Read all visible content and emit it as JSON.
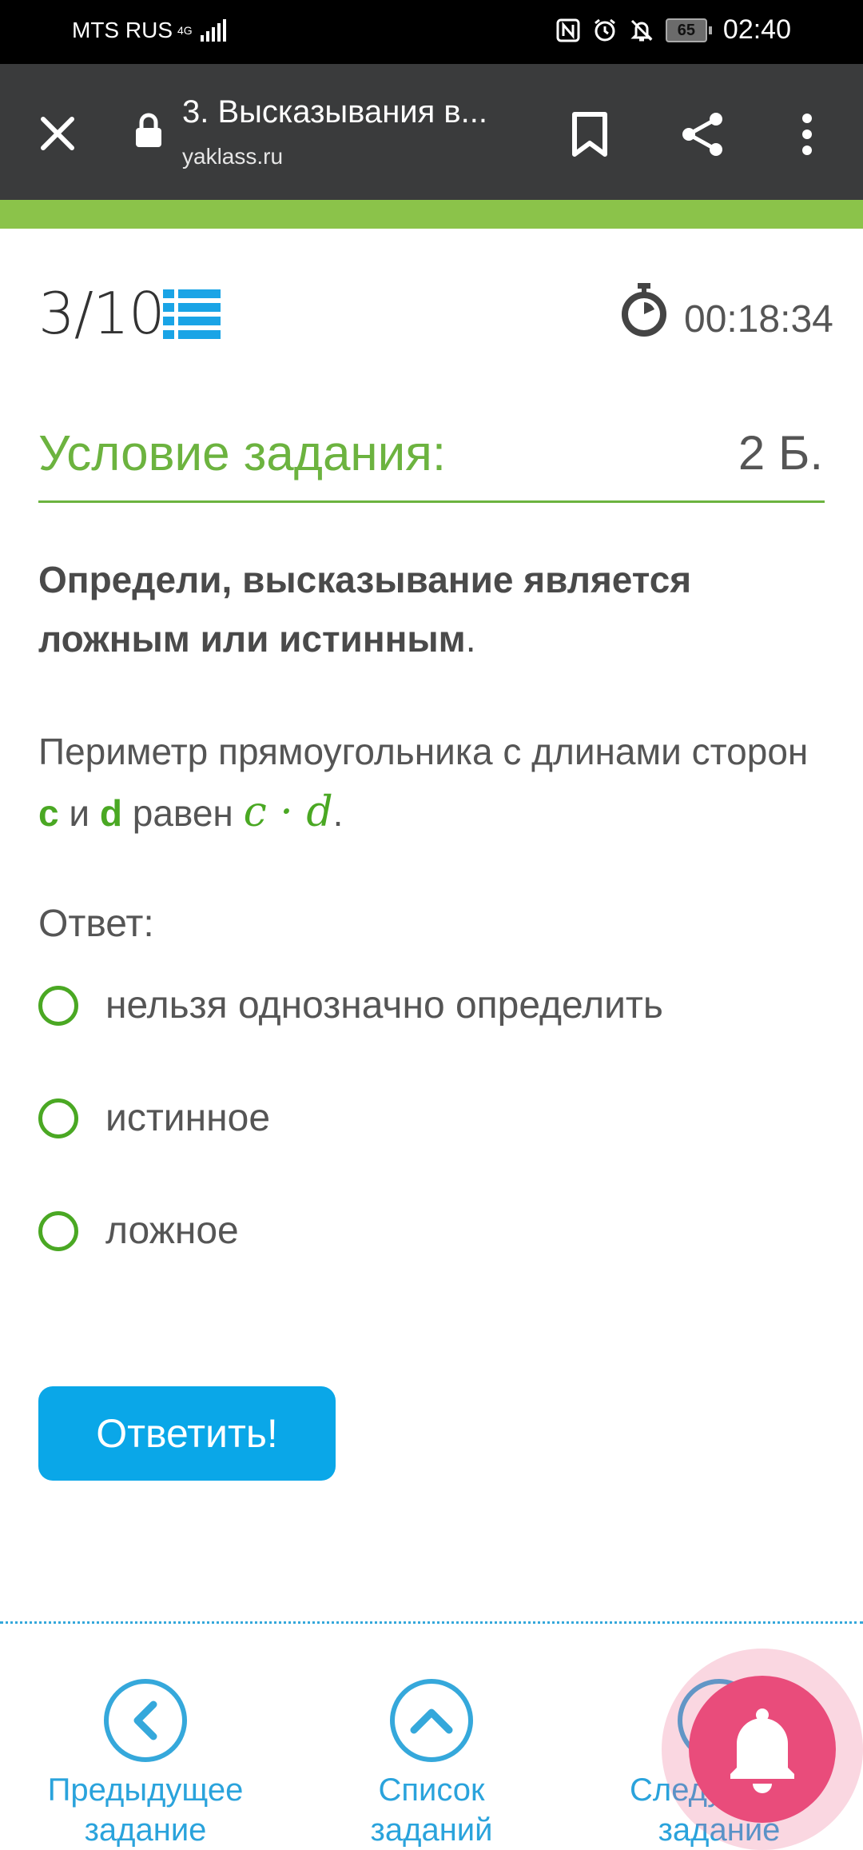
{
  "status_bar": {
    "carrier": "MTS RUS",
    "network": "4G",
    "battery": "65",
    "time": "02:40"
  },
  "browser": {
    "title": "3. Высказывания в...",
    "url": "yaklass.ru",
    "icons": [
      "close-icon",
      "lock-icon",
      "bookmark-icon",
      "share-icon",
      "more-vertical-icon"
    ]
  },
  "header": {
    "progress": "3/10",
    "timer": "00:18:34"
  },
  "section": {
    "title": "Условие задания:",
    "points": "2 Б."
  },
  "question": {
    "instruction": "Определи, высказывание является ложным или истинным",
    "instruction_end": ".",
    "statement_part1": "Периметр прямоугольника с длинами сторон ",
    "var_c": "c",
    "statement_part2": " и ",
    "var_d": "d",
    "statement_part3": " равен ",
    "formula": "c · d",
    "statement_end": "."
  },
  "answer": {
    "label": "Ответ:",
    "options": [
      "нельзя однозначно определить",
      "истинное",
      "ложное"
    ]
  },
  "submit_label": "Ответить!",
  "bottom_nav": {
    "prev": "Предыдущее задание",
    "list": "Список заданий",
    "next": "Следующее задание"
  },
  "colors": {
    "green": "#6cb33f",
    "blue": "#0aa7e8",
    "toolbar": "#3a3b3c",
    "fab": "#e94c7b"
  }
}
